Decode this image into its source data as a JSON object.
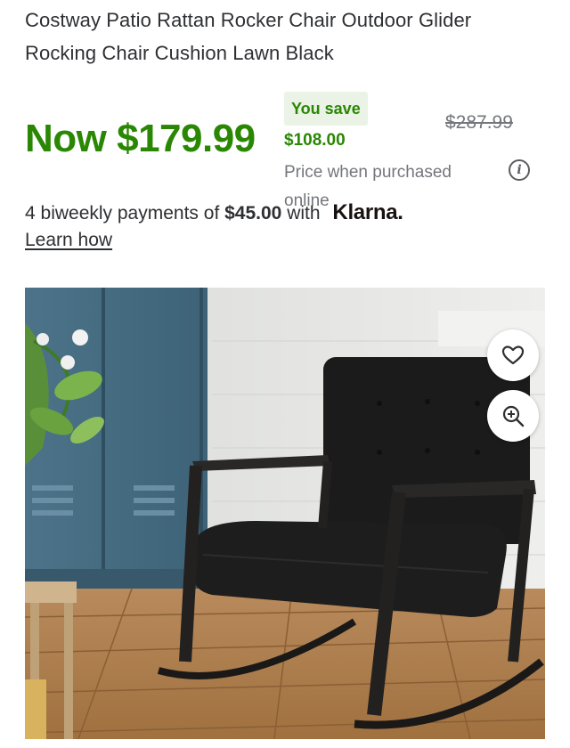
{
  "product": {
    "title": "Costway Patio Rattan Rocker Chair Outdoor Glider Rocking Chair Cushion Lawn Black"
  },
  "pricing": {
    "now_price": "Now $179.99",
    "you_save_label": "You save",
    "save_amount": "$108.00",
    "was_price": "$287.99",
    "price_note": "Price when purchased online"
  },
  "klarna": {
    "prefix": "4 biweekly payments of",
    "amount": "$45.00",
    "suffix": "with",
    "logo_text": "Klarna.",
    "learn_how": "Learn how"
  },
  "image": {
    "alt": "Black rattan rocking chair with black cushions on wooden deck",
    "favorite_icon": "heart-icon",
    "zoom_icon": "zoom-in-icon"
  },
  "colors": {
    "price_green": "#2a8703",
    "save_pill_bg": "#eaf3e6",
    "muted_text": "#74767c"
  }
}
